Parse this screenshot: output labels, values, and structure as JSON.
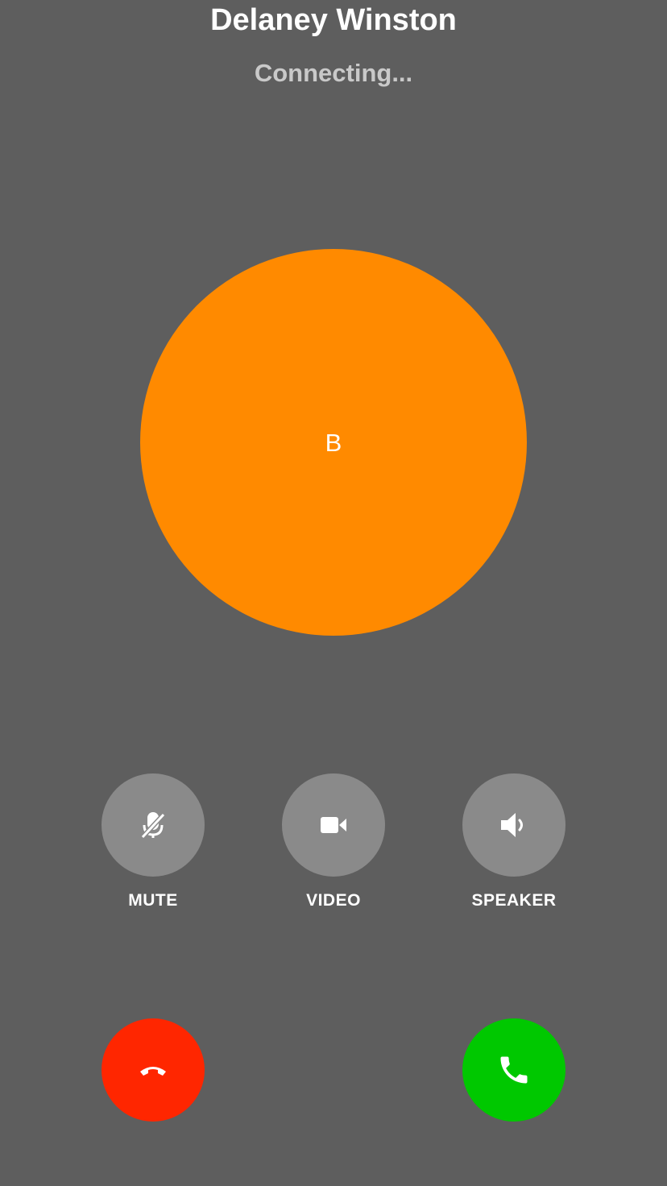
{
  "call": {
    "caller_name": "Delaney Winston",
    "status": "Connecting...",
    "avatar_initial": "B"
  },
  "controls": {
    "mute_label": "MUTE",
    "video_label": "VIDEO",
    "speaker_label": "SPEAKER"
  },
  "icons": {
    "mute": "microphone-off-icon",
    "video": "video-camera-icon",
    "speaker": "speaker-icon",
    "decline": "phone-hangup-icon",
    "accept": "phone-icon"
  },
  "colors": {
    "background": "#5e5e5e",
    "avatar": "#ff8a00",
    "control_button": "#8a8a8a",
    "decline": "#ff2600",
    "accept": "#00c800",
    "status_text": "#c9c9c9"
  }
}
